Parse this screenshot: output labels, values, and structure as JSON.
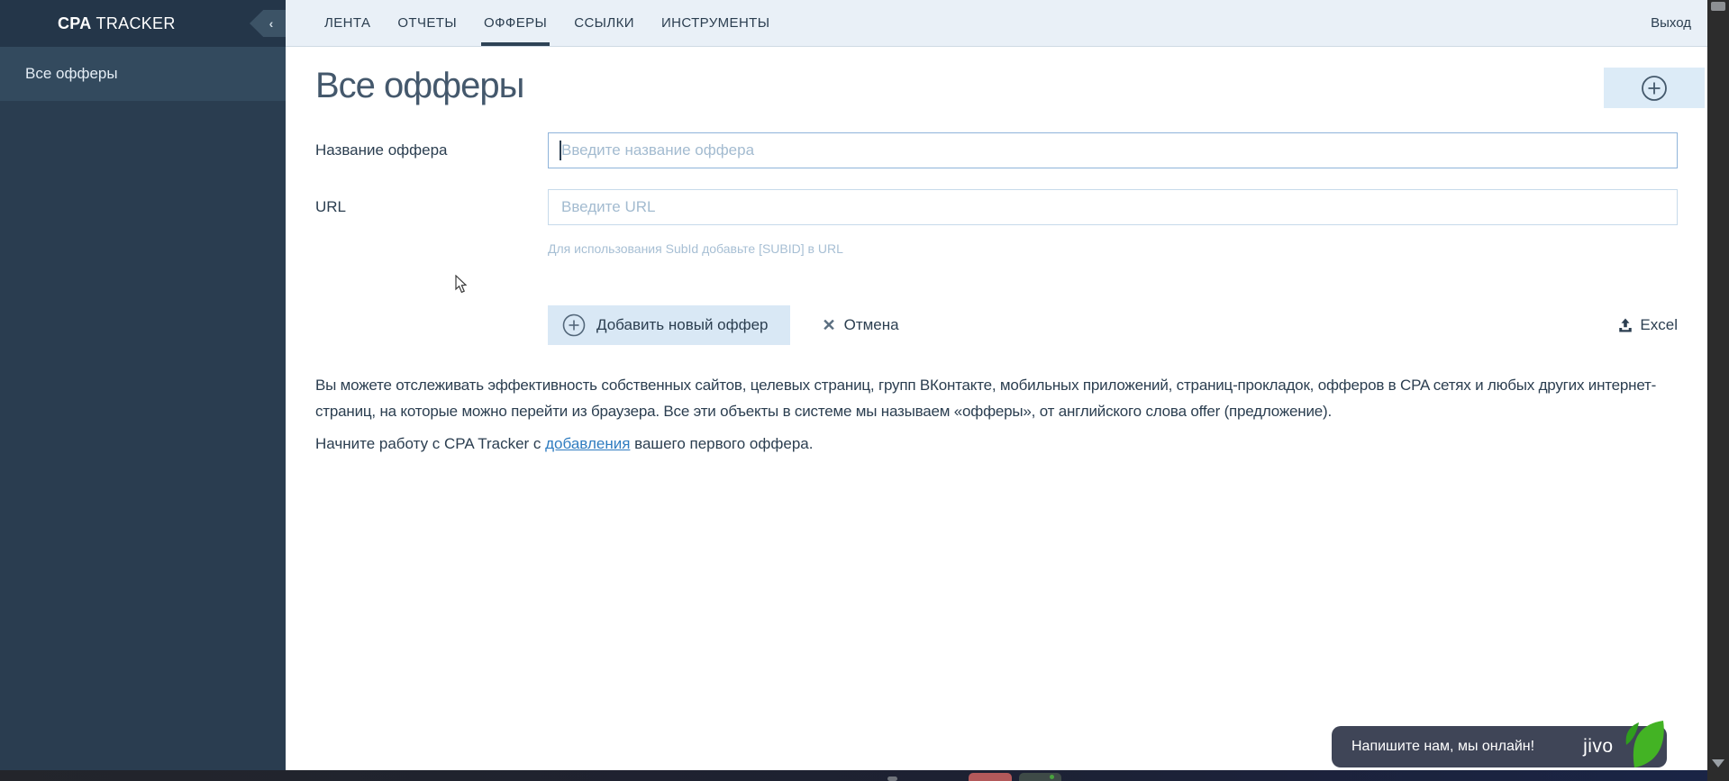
{
  "app": {
    "brand_bold": "CPA",
    "brand_rest": " TRACKER",
    "collapse_glyph": "‹"
  },
  "sidebar": {
    "items": [
      {
        "label": "Все офферы"
      }
    ]
  },
  "nav": {
    "tabs": [
      {
        "label": "ЛЕНТА"
      },
      {
        "label": "ОТЧЕТЫ"
      },
      {
        "label": "ОФФЕРЫ"
      },
      {
        "label": "ССЫЛКИ"
      },
      {
        "label": "ИНСТРУМЕНТЫ"
      }
    ],
    "active_tab": "ОФФЕРЫ",
    "logout_label": "Выход"
  },
  "page": {
    "title": "Все офферы"
  },
  "form": {
    "name_label": "Название оффера",
    "name_placeholder": "Введите название оффера",
    "name_value": "",
    "url_label": "URL",
    "url_placeholder": "Введите URL",
    "url_value": "",
    "url_hint": "Для использования SubId добавьте [SUBID] в URL",
    "submit_label": "Добавить новый оффер",
    "cancel_label": "Отмена",
    "excel_label": "Excel"
  },
  "description": {
    "paragraph1": "Вы можете отслеживать эффективность собственных сайтов, целевых страниц, групп ВКонтакте, мобильных приложений, страниц-прокладок, офферов в CPA сетях и любых других интернет-страниц, на которые можно перейти из браузера. Все эти объекты в системе мы называем «офферы», от английского слова offer (предложение).",
    "paragraph2_before": "Начните работу с CPA Tracker с ",
    "paragraph2_link": "добавления",
    "paragraph2_after": " вашего первого оффера."
  },
  "chat": {
    "message": "Напишите нам, мы онлайн!",
    "brand": "jivo"
  },
  "colors": {
    "sidebar_bg": "#2a3d50",
    "sidebar_header_bg": "#243649",
    "sidebar_item_bg": "#334a5e",
    "nav_bg": "#e9f0f7",
    "accent_text": "#2b3e50",
    "button_bg": "#d9e8f5",
    "link": "#2f7cc0",
    "placeholder": "#a3bbd0",
    "chat_bg": "#3f4557",
    "chat_green": "#43b324"
  }
}
